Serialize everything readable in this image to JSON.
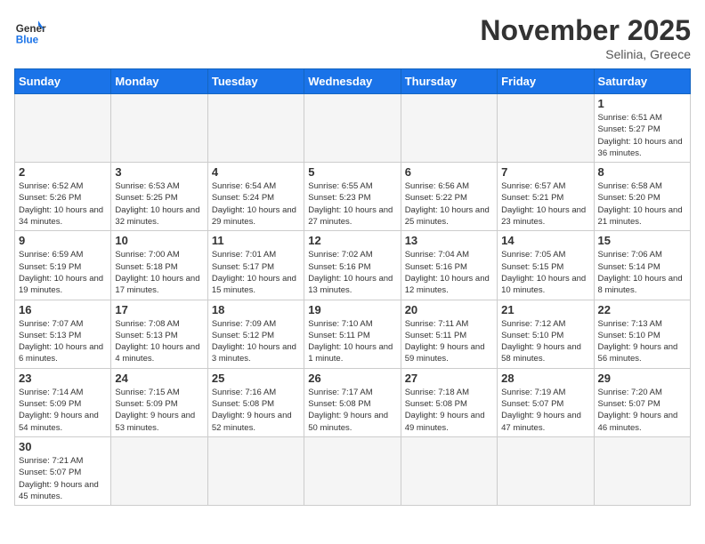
{
  "header": {
    "logo_general": "General",
    "logo_blue": "Blue",
    "month_title": "November 2025",
    "subtitle": "Selinia, Greece"
  },
  "weekdays": [
    "Sunday",
    "Monday",
    "Tuesday",
    "Wednesday",
    "Thursday",
    "Friday",
    "Saturday"
  ],
  "days": {
    "d1": {
      "num": "1",
      "rise": "6:51 AM",
      "set": "5:27 PM",
      "daylight": "10 hours and 36 minutes."
    },
    "d2": {
      "num": "2",
      "rise": "6:52 AM",
      "set": "5:26 PM",
      "daylight": "10 hours and 34 minutes."
    },
    "d3": {
      "num": "3",
      "rise": "6:53 AM",
      "set": "5:25 PM",
      "daylight": "10 hours and 32 minutes."
    },
    "d4": {
      "num": "4",
      "rise": "6:54 AM",
      "set": "5:24 PM",
      "daylight": "10 hours and 29 minutes."
    },
    "d5": {
      "num": "5",
      "rise": "6:55 AM",
      "set": "5:23 PM",
      "daylight": "10 hours and 27 minutes."
    },
    "d6": {
      "num": "6",
      "rise": "6:56 AM",
      "set": "5:22 PM",
      "daylight": "10 hours and 25 minutes."
    },
    "d7": {
      "num": "7",
      "rise": "6:57 AM",
      "set": "5:21 PM",
      "daylight": "10 hours and 23 minutes."
    },
    "d8": {
      "num": "8",
      "rise": "6:58 AM",
      "set": "5:20 PM",
      "daylight": "10 hours and 21 minutes."
    },
    "d9": {
      "num": "9",
      "rise": "6:59 AM",
      "set": "5:19 PM",
      "daylight": "10 hours and 19 minutes."
    },
    "d10": {
      "num": "10",
      "rise": "7:00 AM",
      "set": "5:18 PM",
      "daylight": "10 hours and 17 minutes."
    },
    "d11": {
      "num": "11",
      "rise": "7:01 AM",
      "set": "5:17 PM",
      "daylight": "10 hours and 15 minutes."
    },
    "d12": {
      "num": "12",
      "rise": "7:02 AM",
      "set": "5:16 PM",
      "daylight": "10 hours and 13 minutes."
    },
    "d13": {
      "num": "13",
      "rise": "7:04 AM",
      "set": "5:16 PM",
      "daylight": "10 hours and 12 minutes."
    },
    "d14": {
      "num": "14",
      "rise": "7:05 AM",
      "set": "5:15 PM",
      "daylight": "10 hours and 10 minutes."
    },
    "d15": {
      "num": "15",
      "rise": "7:06 AM",
      "set": "5:14 PM",
      "daylight": "10 hours and 8 minutes."
    },
    "d16": {
      "num": "16",
      "rise": "7:07 AM",
      "set": "5:13 PM",
      "daylight": "10 hours and 6 minutes."
    },
    "d17": {
      "num": "17",
      "rise": "7:08 AM",
      "set": "5:13 PM",
      "daylight": "10 hours and 4 minutes."
    },
    "d18": {
      "num": "18",
      "rise": "7:09 AM",
      "set": "5:12 PM",
      "daylight": "10 hours and 3 minutes."
    },
    "d19": {
      "num": "19",
      "rise": "7:10 AM",
      "set": "5:11 PM",
      "daylight": "10 hours and 1 minute."
    },
    "d20": {
      "num": "20",
      "rise": "7:11 AM",
      "set": "5:11 PM",
      "daylight": "9 hours and 59 minutes."
    },
    "d21": {
      "num": "21",
      "rise": "7:12 AM",
      "set": "5:10 PM",
      "daylight": "9 hours and 58 minutes."
    },
    "d22": {
      "num": "22",
      "rise": "7:13 AM",
      "set": "5:10 PM",
      "daylight": "9 hours and 56 minutes."
    },
    "d23": {
      "num": "23",
      "rise": "7:14 AM",
      "set": "5:09 PM",
      "daylight": "9 hours and 54 minutes."
    },
    "d24": {
      "num": "24",
      "rise": "7:15 AM",
      "set": "5:09 PM",
      "daylight": "9 hours and 53 minutes."
    },
    "d25": {
      "num": "25",
      "rise": "7:16 AM",
      "set": "5:08 PM",
      "daylight": "9 hours and 52 minutes."
    },
    "d26": {
      "num": "26",
      "rise": "7:17 AM",
      "set": "5:08 PM",
      "daylight": "9 hours and 50 minutes."
    },
    "d27": {
      "num": "27",
      "rise": "7:18 AM",
      "set": "5:08 PM",
      "daylight": "9 hours and 49 minutes."
    },
    "d28": {
      "num": "28",
      "rise": "7:19 AM",
      "set": "5:07 PM",
      "daylight": "9 hours and 47 minutes."
    },
    "d29": {
      "num": "29",
      "rise": "7:20 AM",
      "set": "5:07 PM",
      "daylight": "9 hours and 46 minutes."
    },
    "d30": {
      "num": "30",
      "rise": "7:21 AM",
      "set": "5:07 PM",
      "daylight": "9 hours and 45 minutes."
    }
  }
}
